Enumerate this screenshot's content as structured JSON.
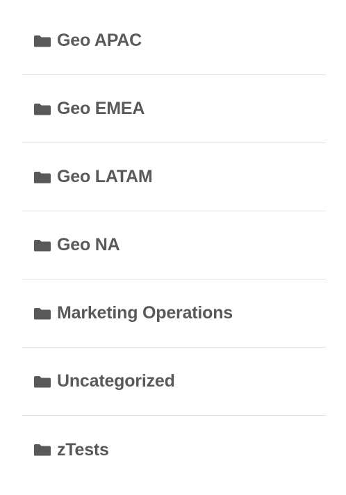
{
  "folders": [
    {
      "label": "Geo APAC",
      "icon": "folder-icon"
    },
    {
      "label": "Geo EMEA",
      "icon": "folder-icon"
    },
    {
      "label": "Geo LATAM",
      "icon": "folder-icon"
    },
    {
      "label": "Geo NA",
      "icon": "folder-icon"
    },
    {
      "label": "Marketing Operations",
      "icon": "folder-icon"
    },
    {
      "label": "Uncategorized",
      "icon": "folder-icon"
    },
    {
      "label": "zTests",
      "icon": "folder-icon"
    }
  ],
  "colors": {
    "text": "#595959",
    "icon": "#595959",
    "divider": "#e3e3e3",
    "background": "#ffffff"
  }
}
